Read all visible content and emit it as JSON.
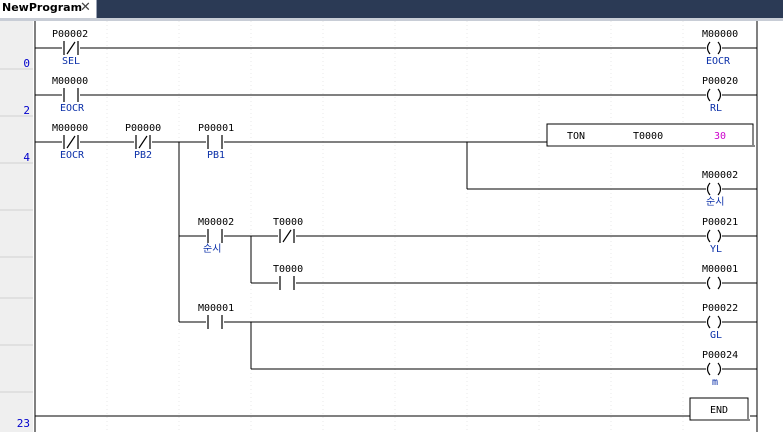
{
  "tab": {
    "title": "NewProgram",
    "close": "✕"
  },
  "steps": [
    "0",
    "2",
    "4",
    "23"
  ],
  "rungs": [
    {
      "contacts": [
        {
          "device": "P00002",
          "comment": "SEL",
          "type": "NC"
        }
      ],
      "coil": {
        "device": "M00000",
        "comment": "EOCR"
      }
    },
    {
      "contacts": [
        {
          "device": "M00000",
          "comment": "EOCR",
          "type": "NO"
        }
      ],
      "coil": {
        "device": "P00020",
        "comment": "RL"
      }
    },
    {
      "contacts": [
        {
          "device": "M00000",
          "comment": "EOCR",
          "type": "NC"
        },
        {
          "device": "P00000",
          "comment": "PB2",
          "type": "NC"
        },
        {
          "device": "P00001",
          "comment": "PB1",
          "type": "NO"
        }
      ],
      "timer": {
        "instruction": "TON",
        "device": "T0000",
        "preset": "30"
      },
      "coil": {
        "device": "M00002",
        "comment": "순시"
      },
      "branches": [
        {
          "contacts": [
            {
              "device": "M00002",
              "comment": "순시",
              "type": "NO"
            },
            {
              "device": "T0000",
              "comment": "",
              "type": "NC"
            }
          ],
          "coil": {
            "device": "P00021",
            "comment": "YL"
          }
        },
        {
          "contacts": [
            {
              "device": "T0000",
              "comment": "",
              "type": "NO"
            }
          ],
          "coil": {
            "device": "M00001",
            "comment": ""
          }
        },
        {
          "contacts": [
            {
              "device": "M00001",
              "comment": "",
              "type": "NO"
            }
          ],
          "coil": {
            "device": "P00022",
            "comment": "GL"
          }
        },
        {
          "coil": {
            "device": "P00024",
            "comment": "m"
          }
        }
      ]
    }
  ],
  "end": {
    "label": "END"
  },
  "colors": {
    "tabbar": "#2b3a55",
    "step": "#0000cc",
    "comment": "#0a2fa8",
    "preset": "#cc00cc"
  }
}
